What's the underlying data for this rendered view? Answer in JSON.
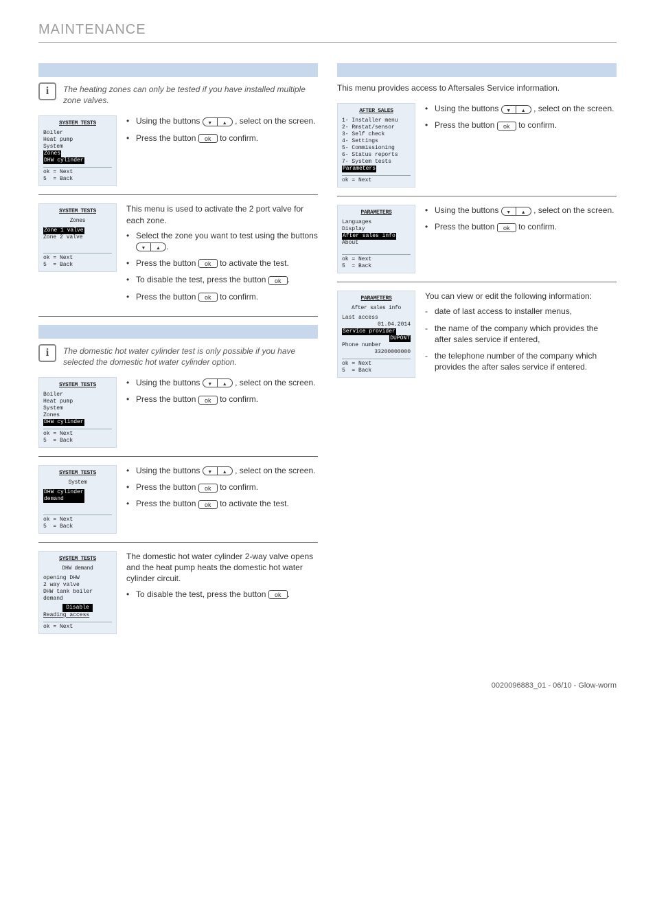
{
  "header": {
    "title": "MAINTENANCE"
  },
  "footer": {
    "text": "0020096883_01 - 06/10 - Glow-worm"
  },
  "left": {
    "note1": "The heating zones can only be tested if you have installed multiple zone valves.",
    "step1": {
      "li1a": "Using the buttons ",
      "li1b": " , select",
      "li1c": " on the screen.",
      "li2a": "Press the button ",
      "li2b": " to confirm."
    },
    "step2": {
      "intro": "This menu is used to activate the 2 port valve for each zone.",
      "li1a": "Select the zone you want to test using the buttons ",
      "li1b": ".",
      "li2a": "Press the button ",
      "li2b": " to activate the test.",
      "li3a": "To disable the test, press the button ",
      "li3b": ".",
      "li4a": "Press the button ",
      "li4b": " to confirm."
    },
    "note2": "The domestic hot water cylinder test is only possible if you have selected the domestic hot water cylinder option.",
    "step3": {
      "li1a": "Using the buttons ",
      "li1b": " , select",
      "li1c": " on the screen.",
      "li2a": "Press the button ",
      "li2b": " to confirm."
    },
    "step4": {
      "li1a": "Using the buttons ",
      "li1b": " , select",
      "li1c": " on the screen.",
      "li2a": "Press the button ",
      "li2b": " to confirm.",
      "li3a": "Press the button ",
      "li3b": " to activate the test."
    },
    "step5": {
      "intro": "The domestic hot water cylinder 2-way valve opens and the heat pump heats the domestic hot water cylinder circuit.",
      "li1a": "To disable the test, press the button ",
      "li1b": "."
    },
    "screens": {
      "s1": {
        "title": "SYSTEM TESTS",
        "items": [
          "Boiler",
          "Heat pump",
          "",
          "System",
          ""
        ],
        "hl1": "Zones",
        "hl2": "DHW cylinder",
        "foot": "ok = Next\n5  = Back"
      },
      "s2": {
        "title": "SYSTEM TESTS",
        "sub": "Zones",
        "hl": "Zone 1 valve",
        "item": "Zone 2 valve",
        "foot": "ok = Next\n5  = Back"
      },
      "s3": {
        "title": "SYSTEM TESTS",
        "items": [
          "Boiler",
          "Heat pump",
          "",
          "System",
          "",
          "Zones"
        ],
        "hl": "DHW cylinder",
        "foot": "ok = Next\n5  = Back"
      },
      "s4": {
        "title": "SYSTEM TESTS",
        "sub": "System",
        "hl": "DHW cylinder\ndemand",
        "foot": "ok = Next\n5  = Back"
      },
      "s5": {
        "title": "SYSTEM TESTS",
        "sub": "DHW demand",
        "items": [
          "opening DHW",
          "2 way valve",
          "",
          "DHW tank boiler",
          "demand"
        ],
        "btn": "Disable",
        "read": "Reading access",
        "foot": "ok = Next"
      }
    }
  },
  "right": {
    "intro": "This menu provides access to Aftersales Service information.",
    "step1": {
      "li1a": "Using the buttons ",
      "li1b": " , select",
      "li1c": " on the screen.",
      "li2a": "Press the button ",
      "li2b": " to confirm."
    },
    "step2": {
      "li1a": "Using the buttons ",
      "li1b": " , select",
      "li1c": " on the screen.",
      "li2a": "Press the button ",
      "li2b": " to confirm."
    },
    "step3": {
      "intro": "You can view or edit the following information:",
      "d1": "date of last access to installer menus,",
      "d2": "the name of the company which provides the after sales service if entered,",
      "d3": "the telephone number of the company which provides the after sales service if entered."
    },
    "screens": {
      "s1": {
        "title": "AFTER SALES",
        "items": [
          "1- Installer menu",
          "2- Rmstat/sensor",
          "3- Self check",
          "4- Settings",
          "5- Commissioning",
          "",
          "6- Status reports",
          "7- System tests"
        ],
        "hl": "Parameters",
        "foot": "ok = Next"
      },
      "s2": {
        "title": "PARAMETERS",
        "items": [
          "",
          "Languages",
          "Display"
        ],
        "hl": "After sales info",
        "items2": [
          "",
          "About"
        ],
        "foot": "ok = Next\n5  = Back"
      },
      "s3": {
        "title": "PARAMETERS",
        "sub": "After sales info",
        "l1": "Last access",
        "l1v": "01.04.2014",
        "hl": "Service provider",
        "hlv": "DUPONT",
        "l2": "Phone number",
        "l2v": "33200000000",
        "foot": "ok = Next\n5  = Back"
      }
    }
  }
}
